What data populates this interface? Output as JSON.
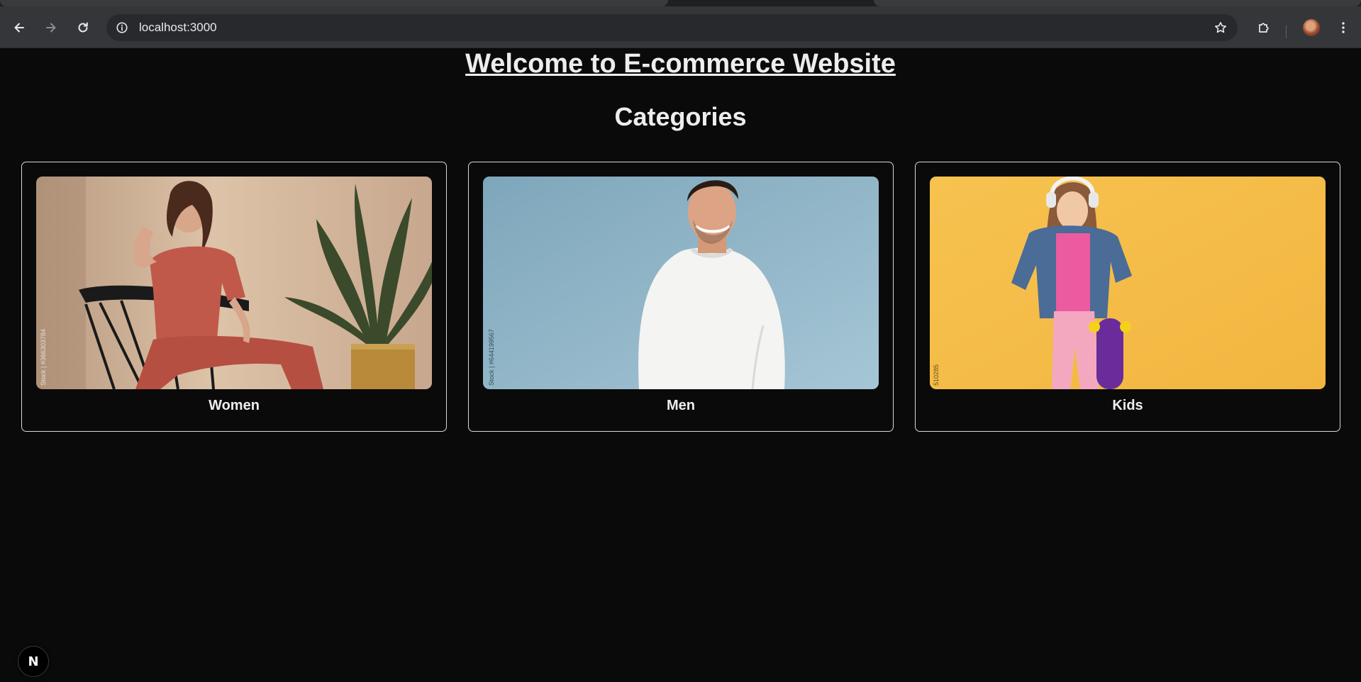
{
  "browser": {
    "url": "localhost:3000",
    "icons": {
      "back": "arrow-left-icon",
      "forward": "arrow-right-icon",
      "reload": "reload-icon",
      "site_info": "info-icon",
      "bookmark": "star-icon",
      "extensions": "puzzle-icon",
      "menu": "kebab-menu-icon"
    }
  },
  "page": {
    "title": "Welcome to E-commerce Website",
    "categories_heading": "Categories",
    "categories": [
      {
        "label": "Women",
        "image_bg": "#c9ab8d",
        "watermark": "Stock | #366303784"
      },
      {
        "label": "Men",
        "image_bg": "#8fb3c6",
        "watermark": "Stock | #644199567"
      },
      {
        "label": "Kids",
        "image_bg": "#f6bf4f",
        "watermark": "510285"
      }
    ]
  },
  "dev_badge": {
    "label": "N"
  },
  "colors": {
    "background": "#0a0a0a",
    "foreground": "#ededed",
    "card_border": "#d9d9d9",
    "chrome_toolbar": "#35363a",
    "omnibox": "#28292c"
  }
}
